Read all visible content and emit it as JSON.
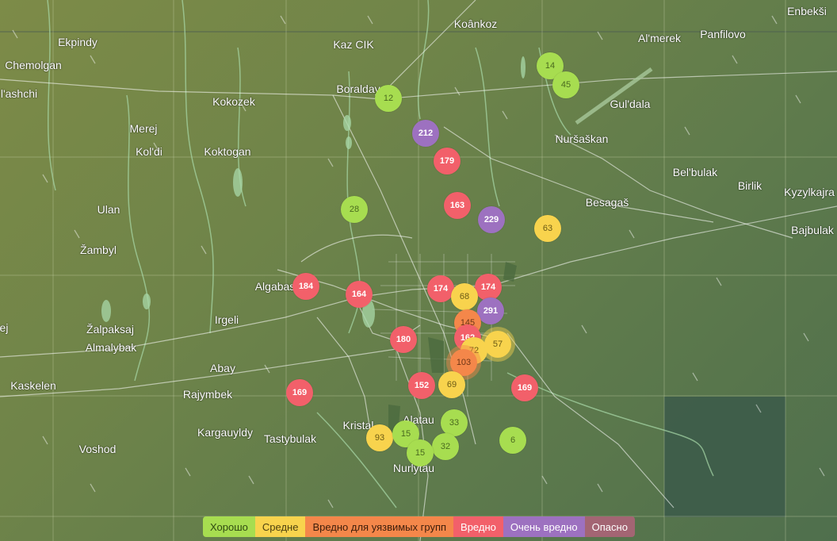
{
  "colors": {
    "good": "#a7dd50",
    "moderate": "#f8d34d",
    "usg": "#f4874a",
    "unhealthy": "#f2606a",
    "very_unhealthy": "#9d71c0",
    "hazardous": "#a36573"
  },
  "places": [
    {
      "name": "Enbekši"
    },
    {
      "name": "Koânkoz"
    },
    {
      "name": "Al'merek"
    },
    {
      "name": "Panfilovo"
    },
    {
      "name": "Ekpindy"
    },
    {
      "name": "Kaz CIK"
    },
    {
      "name": "Chemolgan"
    },
    {
      "name": "l'ashchi"
    },
    {
      "name": "Boralday"
    },
    {
      "name": "Kokozek"
    },
    {
      "name": "Gul'dala"
    },
    {
      "name": "Merej"
    },
    {
      "name": "Kol'di"
    },
    {
      "name": "Koktogan"
    },
    {
      "name": "Nuršaškan"
    },
    {
      "name": "Bel'bulak"
    },
    {
      "name": "Birlik"
    },
    {
      "name": "Kyzylkajra"
    },
    {
      "name": "Ulan"
    },
    {
      "name": "Besagaš"
    },
    {
      "name": "Bajbulak"
    },
    {
      "name": "Žambyl"
    },
    {
      "name": "Algabas"
    },
    {
      "name": "ej"
    },
    {
      "name": "Irgeli"
    },
    {
      "name": "Žalpaksaj"
    },
    {
      "name": "Almalybak"
    },
    {
      "name": "Abay"
    },
    {
      "name": "Kaskelen"
    },
    {
      "name": "Rajymbek"
    },
    {
      "name": "Kristal"
    },
    {
      "name": "Alatau"
    },
    {
      "name": "Kargauyldy"
    },
    {
      "name": "Tastybulak"
    },
    {
      "name": "Voshod"
    },
    {
      "name": "Nurlytau"
    }
  ],
  "markers": [
    {
      "value": "14",
      "level": "good"
    },
    {
      "value": "45",
      "level": "good"
    },
    {
      "value": "12",
      "level": "good"
    },
    {
      "value": "212",
      "level": "very_unhealthy"
    },
    {
      "value": "179",
      "level": "unhealthy"
    },
    {
      "value": "28",
      "level": "good"
    },
    {
      "value": "163",
      "level": "unhealthy"
    },
    {
      "value": "229",
      "level": "very_unhealthy"
    },
    {
      "value": "63",
      "level": "moderate"
    },
    {
      "value": "184",
      "level": "unhealthy"
    },
    {
      "value": "164",
      "level": "unhealthy"
    },
    {
      "value": "174",
      "level": "unhealthy"
    },
    {
      "value": "174",
      "level": "unhealthy"
    },
    {
      "value": "68",
      "level": "moderate"
    },
    {
      "value": "291",
      "level": "very_unhealthy"
    },
    {
      "value": "145",
      "level": "usg"
    },
    {
      "value": "180",
      "level": "unhealthy"
    },
    {
      "value": "162",
      "level": "unhealthy"
    },
    {
      "value": "72",
      "level": "moderate"
    },
    {
      "value": "57",
      "level": "moderate"
    },
    {
      "value": "103",
      "level": "usg"
    },
    {
      "value": "169",
      "level": "unhealthy"
    },
    {
      "value": "152",
      "level": "unhealthy"
    },
    {
      "value": "69",
      "level": "moderate"
    },
    {
      "value": "169",
      "level": "unhealthy"
    },
    {
      "value": "33",
      "level": "good"
    },
    {
      "value": "93",
      "level": "moderate"
    },
    {
      "value": "15",
      "level": "good"
    },
    {
      "value": "6",
      "level": "good"
    },
    {
      "value": "32",
      "level": "good"
    },
    {
      "value": "15",
      "level": "good"
    }
  ],
  "legend": [
    {
      "label": "Хорошо",
      "bg": "#a7dd50",
      "fg": "#2f4a12"
    },
    {
      "label": "Средне",
      "bg": "#f8d34d",
      "fg": "#4d4110"
    },
    {
      "label": "Вредно для уязвимых групп",
      "bg": "#f4874a",
      "fg": "#3d1d0b"
    },
    {
      "label": "Вредно",
      "bg": "#f2606a",
      "fg": "#ffffff"
    },
    {
      "label": "Очень вредно",
      "bg": "#9d71c0",
      "fg": "#ffffff"
    },
    {
      "label": "Опасно",
      "bg": "#a36573",
      "fg": "#ffffff"
    }
  ]
}
